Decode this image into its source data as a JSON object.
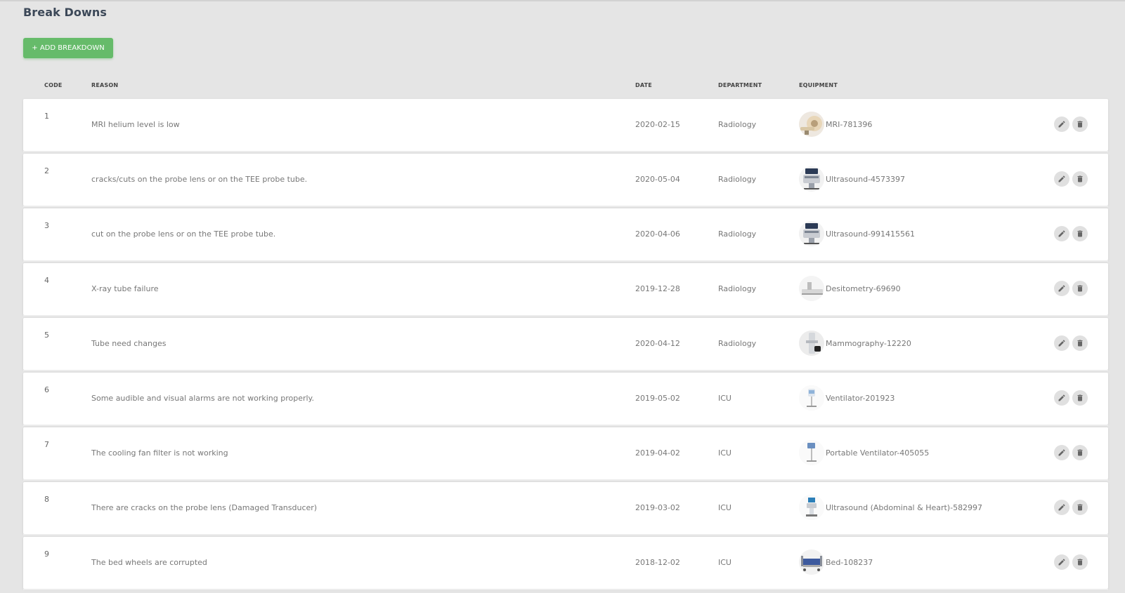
{
  "page": {
    "title": "Break Downs"
  },
  "toolbar": {
    "add_label": "+ ADD BREAKDOWN"
  },
  "table": {
    "headers": {
      "code": "CODE",
      "reason": "REASON",
      "date": "DATE",
      "department": "DEPARTMENT",
      "equipment": "EQUIPMENT"
    },
    "rows": [
      {
        "code": "1",
        "reason": "MRI helium level is low",
        "date": "2020-02-15",
        "department": "Radiology",
        "equipment": "MRI-781396",
        "equipment_icon": "mri-scanner-icon"
      },
      {
        "code": "2",
        "reason": "cracks/cuts on the probe lens or on the TEE probe tube.",
        "date": "2020-05-04",
        "department": "Radiology",
        "equipment": "Ultrasound-4573397",
        "equipment_icon": "ultrasound-icon"
      },
      {
        "code": "3",
        "reason": "cut on the probe lens or on the TEE probe tube.",
        "date": "2020-04-06",
        "department": "Radiology",
        "equipment": "Ultrasound-991415561",
        "equipment_icon": "ultrasound-icon"
      },
      {
        "code": "4",
        "reason": "X-ray tube failure",
        "date": "2019-12-28",
        "department": "Radiology",
        "equipment": "Desitometry-69690",
        "equipment_icon": "densitometer-icon"
      },
      {
        "code": "5",
        "reason": "Tube need changes",
        "date": "2020-04-12",
        "department": "Radiology",
        "equipment": "Mammography-12220",
        "equipment_icon": "mammography-icon"
      },
      {
        "code": "6",
        "reason": "Some audible and visual alarms are not working properly.",
        "date": "2019-05-02",
        "department": "ICU",
        "equipment": "Ventilator-201923",
        "equipment_icon": "ventilator-icon"
      },
      {
        "code": "7",
        "reason": "The cooling fan filter is not working",
        "date": "2019-04-02",
        "department": "ICU",
        "equipment": "Portable Ventilator-405055",
        "equipment_icon": "portable-ventilator-icon"
      },
      {
        "code": "8",
        "reason": "There are cracks on the probe lens (Damaged Transducer)",
        "date": "2019-03-02",
        "department": "ICU",
        "equipment": "Ultrasound (Abdominal & Heart)-582997",
        "equipment_icon": "ultrasound-cart-icon"
      },
      {
        "code": "9",
        "reason": "The bed wheels are corrupted",
        "date": "2018-12-02",
        "department": "ICU",
        "equipment": "Bed-108237",
        "equipment_icon": "hospital-bed-icon"
      }
    ]
  },
  "actions": {
    "edit_icon": "pencil-icon",
    "delete_icon": "trash-icon"
  },
  "colors": {
    "accent": "#66bb6a",
    "background": "#e5e5e5",
    "row_bg": "#ffffff",
    "action_bg": "#e0e0e0"
  }
}
